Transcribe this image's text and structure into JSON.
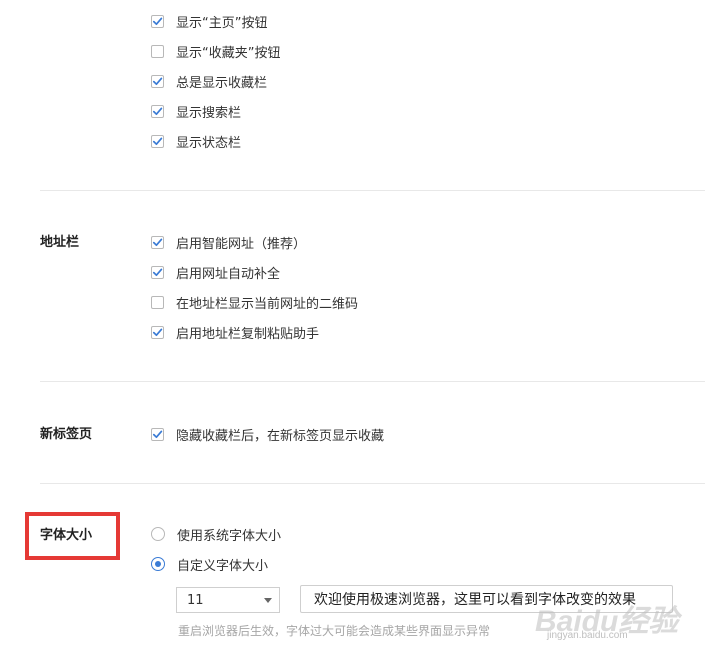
{
  "top_section": {
    "options": [
      {
        "label": "显示“主页”按钮",
        "checked": true
      },
      {
        "label": "显示“收藏夹”按钮",
        "checked": false
      },
      {
        "label": "总是显示收藏栏",
        "checked": true
      },
      {
        "label": "显示搜索栏",
        "checked": true
      },
      {
        "label": "显示状态栏",
        "checked": true
      }
    ]
  },
  "address_bar": {
    "label": "地址栏",
    "options": [
      {
        "label": "启用智能网址（推荐）",
        "checked": true
      },
      {
        "label": "启用网址自动补全",
        "checked": true
      },
      {
        "label": "在地址栏显示当前网址的二维码",
        "checked": false
      },
      {
        "label": "启用地址栏复制粘贴助手",
        "checked": true
      }
    ]
  },
  "new_tab": {
    "label": "新标签页",
    "options": [
      {
        "label": "隐藏收藏栏后，在新标签页显示收藏",
        "checked": true
      }
    ]
  },
  "font_size": {
    "label": "字体大小",
    "options": [
      {
        "label": "使用系统字体大小",
        "selected": false
      },
      {
        "label": "自定义字体大小",
        "selected": true
      }
    ],
    "size_select_value": "11",
    "preview_text": "欢迎使用极速浏览器，这里可以看到字体改变的效果",
    "hint": "重启浏览器后生效，字体过大可能会造成某些界面显示异常"
  },
  "watermark": {
    "logo": "Baidu经验",
    "url": "jingyan.baidu.com"
  },
  "colors": {
    "checkbox_tick": "#3a7bd5",
    "highlight_box": "#e53935",
    "divider": "#e8e8e8",
    "hint_text": "#a6a6a6"
  },
  "icons": {
    "checkbox_checked": "check-icon",
    "dropdown": "chevron-down-icon"
  }
}
